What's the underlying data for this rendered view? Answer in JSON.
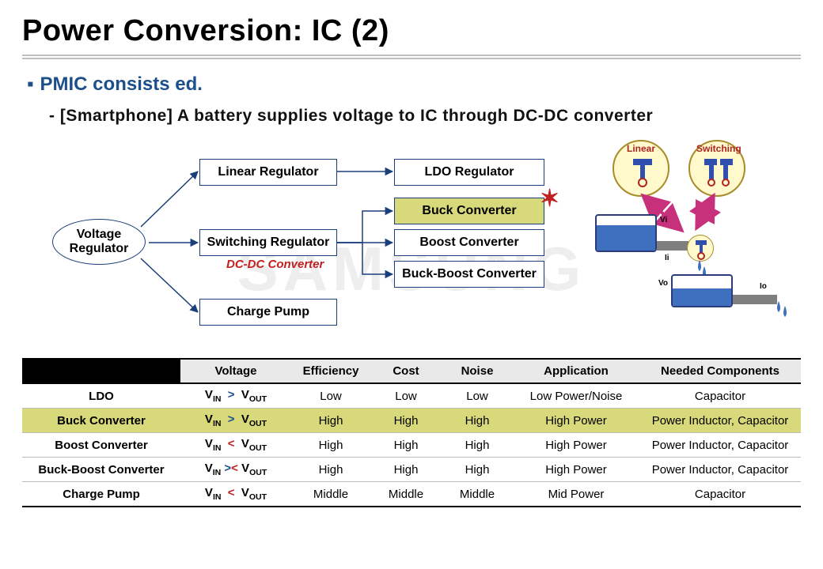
{
  "title": "Power Conversion: IC (2)",
  "bullet1": "PMIC consists ed.",
  "bullet2": "- [Smartphone]  A battery supplies voltage to IC through DC-DC converter",
  "watermark": "SAMSUNG",
  "diagram": {
    "root": "Voltage\nRegulator",
    "l1": [
      "Linear Regulator",
      "Switching Regulator",
      "Charge Pump"
    ],
    "dcdc_note": "DC-DC Converter",
    "l2_from_linear": [
      "LDO Regulator"
    ],
    "l2_from_switching": [
      "Buck Converter",
      "Boost Converter",
      "Buck-Boost Converter"
    ],
    "highlight": "Buck Converter"
  },
  "illus": {
    "circle_labels": [
      "Linear",
      "Switching"
    ],
    "labels": [
      "Vi",
      "Ii",
      "Vo",
      "Io"
    ]
  },
  "table": {
    "headers": [
      "",
      "Voltage",
      "Efficiency",
      "Cost",
      "Noise",
      "Application",
      "Needed  Components"
    ],
    "rows": [
      {
        "name": "LDO",
        "rel": ">",
        "eff": "Low",
        "cost": "Low",
        "noise": "Low",
        "app": "Low Power/Noise",
        "comp": "Capacitor",
        "hl": false
      },
      {
        "name": "Buck Converter",
        "rel": ">",
        "eff": "High",
        "cost": "High",
        "noise": "High",
        "app": "High Power",
        "comp": "Power Inductor, Capacitor",
        "hl": true
      },
      {
        "name": "Boost Converter",
        "rel": "<",
        "eff": "High",
        "cost": "High",
        "noise": "High",
        "app": "High Power",
        "comp": "Power Inductor, Capacitor",
        "hl": false
      },
      {
        "name": "Buck-Boost Converter",
        "rel": "><",
        "eff": "High",
        "cost": "High",
        "noise": "High",
        "app": "High Power",
        "comp": "Power Inductor, Capacitor",
        "hl": false
      },
      {
        "name": "Charge Pump",
        "rel": "<",
        "eff": "Middle",
        "cost": "Middle",
        "noise": "Middle",
        "app": "Mid Power",
        "comp": "Capacitor",
        "hl": false
      }
    ]
  }
}
